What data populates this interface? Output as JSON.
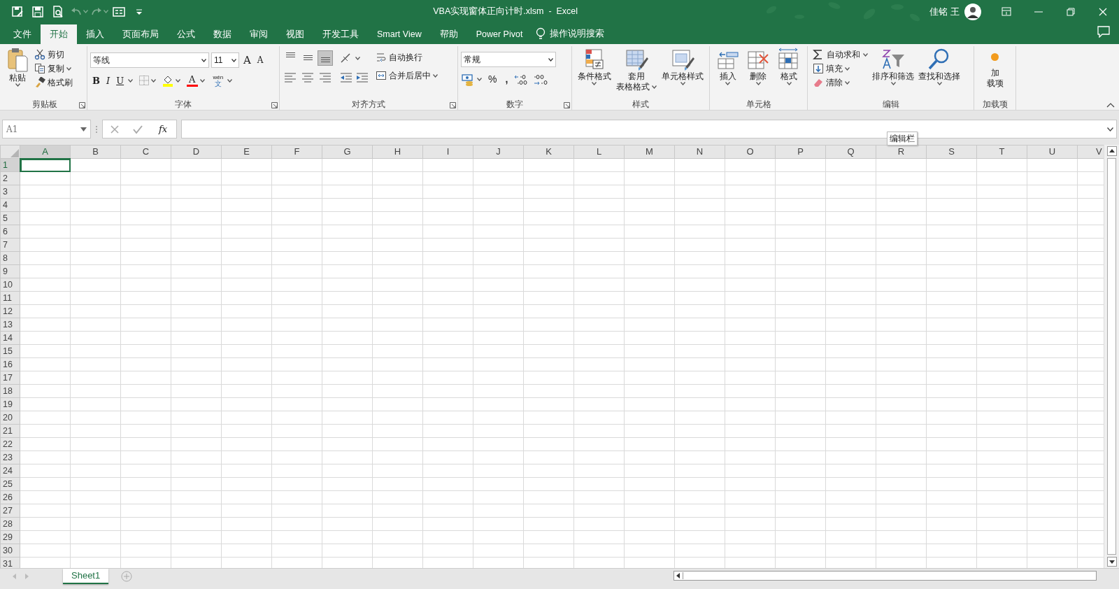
{
  "quick_access": [
    {
      "kind": "edit-save",
      "disabled": false
    },
    {
      "kind": "save",
      "disabled": false
    },
    {
      "kind": "preview",
      "disabled": false
    },
    {
      "kind": "undo",
      "disabled": true
    },
    {
      "kind": "redo",
      "disabled": true
    },
    {
      "kind": "form",
      "disabled": false
    },
    {
      "kind": "customize",
      "disabled": false
    }
  ],
  "window": {
    "title": "VBA实现窗体正向计时.xlsm  -  Excel",
    "user": "佳铭 王"
  },
  "tabs": [
    {
      "label": "文件",
      "selected": false
    },
    {
      "label": "开始",
      "selected": true
    },
    {
      "label": "插入",
      "selected": false
    },
    {
      "label": "页面布局",
      "selected": false
    },
    {
      "label": "公式",
      "selected": false
    },
    {
      "label": "数据",
      "selected": false
    },
    {
      "label": "审阅",
      "selected": false
    },
    {
      "label": "视图",
      "selected": false
    },
    {
      "label": "开发工具",
      "selected": false
    },
    {
      "label": "Smart View",
      "selected": false
    },
    {
      "label": "帮助",
      "selected": false
    },
    {
      "label": "Power Pivot",
      "selected": false
    }
  ],
  "tell_me": "操作说明搜索",
  "ribbon": {
    "clipboard": {
      "title": "剪贴板",
      "paste": "粘贴",
      "items": [
        {
          "kind": "cut",
          "label": "剪切",
          "dropdown": false
        },
        {
          "kind": "copy",
          "label": "复制",
          "dropdown": true
        },
        {
          "kind": "painter",
          "label": "格式刷",
          "dropdown": false
        }
      ]
    },
    "font": {
      "title": "字体",
      "font_name": "等线",
      "font_size": "11",
      "size_buttons": [
        {
          "kind": "grow",
          "glyph": "A"
        },
        {
          "kind": "shrink",
          "glyph": "A"
        }
      ],
      "style_buttons": [
        {
          "kind": "bold",
          "glyph": "B"
        },
        {
          "kind": "italic",
          "glyph": "I"
        },
        {
          "kind": "underline",
          "glyph": "U"
        }
      ],
      "font_color_glyph": "A",
      "phonetic": {
        "top": "wén",
        "bottom": "文"
      }
    },
    "alignment": {
      "title": "对齐方式",
      "vertical": [
        {
          "kind": "top",
          "selected": false
        },
        {
          "kind": "middle",
          "selected": false
        },
        {
          "kind": "bottom",
          "selected": true
        }
      ],
      "horizontal": [
        {
          "kind": "left",
          "selected": false
        },
        {
          "kind": "center",
          "selected": false
        },
        {
          "kind": "right",
          "selected": false
        }
      ],
      "wrap": "自动换行",
      "merge": "合并后居中"
    },
    "number": {
      "title": "数字",
      "format": "常规",
      "percent": "%",
      "comma": ","
    },
    "styles": {
      "title": "样式",
      "buttons": [
        {
          "kind": "conditional",
          "lines": [
            "条件格式"
          ]
        },
        {
          "kind": "table",
          "lines": [
            "套用",
            "表格格式"
          ]
        },
        {
          "kind": "cell-style",
          "lines": [
            "单元格样式"
          ]
        }
      ]
    },
    "cells": {
      "title": "单元格",
      "buttons": [
        {
          "kind": "insert",
          "label": "插入"
        },
        {
          "kind": "delete",
          "label": "删除"
        },
        {
          "kind": "format",
          "label": "格式"
        }
      ]
    },
    "editing": {
      "title": "编辑",
      "small": [
        {
          "kind": "sum",
          "label": "自动求和"
        },
        {
          "kind": "fill",
          "label": "填充"
        },
        {
          "kind": "clear",
          "label": "清除"
        }
      ],
      "large": [
        {
          "kind": "sort",
          "label": "排序和筛选"
        },
        {
          "kind": "find",
          "label": "查找和选择"
        }
      ]
    },
    "addins": {
      "title": "加载项",
      "lines": [
        "加",
        "载项"
      ]
    }
  },
  "formula_bar": {
    "name_box": "A1",
    "fx": "fx",
    "tooltip": "编辑栏"
  },
  "sheet": {
    "columns": [
      {
        "label": "A",
        "selected": true
      },
      {
        "label": "B",
        "selected": false
      },
      {
        "label": "C",
        "selected": false
      },
      {
        "label": "D",
        "selected": false
      },
      {
        "label": "E",
        "selected": false
      },
      {
        "label": "F",
        "selected": false
      },
      {
        "label": "G",
        "selected": false
      },
      {
        "label": "H",
        "selected": false
      },
      {
        "label": "I",
        "selected": false
      },
      {
        "label": "J",
        "selected": false
      },
      {
        "label": "K",
        "selected": false
      },
      {
        "label": "L",
        "selected": false
      },
      {
        "label": "M",
        "selected": false
      },
      {
        "label": "N",
        "selected": false
      },
      {
        "label": "O",
        "selected": false
      },
      {
        "label": "P",
        "selected": false
      },
      {
        "label": "Q",
        "selected": false
      },
      {
        "label": "R",
        "selected": false
      },
      {
        "label": "S",
        "selected": false
      },
      {
        "label": "T",
        "selected": false
      },
      {
        "label": "U",
        "selected": false
      },
      {
        "label": "V",
        "selected": false
      }
    ],
    "rows": [
      {
        "label": "1",
        "selected": true
      },
      {
        "label": "2",
        "selected": false
      },
      {
        "label": "3",
        "selected": false
      },
      {
        "label": "4",
        "selected": false
      },
      {
        "label": "5",
        "selected": false
      },
      {
        "label": "6",
        "selected": false
      },
      {
        "label": "7",
        "selected": false
      },
      {
        "label": "8",
        "selected": false
      },
      {
        "label": "9",
        "selected": false
      },
      {
        "label": "10",
        "selected": false
      },
      {
        "label": "11",
        "selected": false
      },
      {
        "label": "12",
        "selected": false
      },
      {
        "label": "13",
        "selected": false
      },
      {
        "label": "14",
        "selected": false
      },
      {
        "label": "15",
        "selected": false
      },
      {
        "label": "16",
        "selected": false
      },
      {
        "label": "17",
        "selected": false
      },
      {
        "label": "18",
        "selected": false
      },
      {
        "label": "19",
        "selected": false
      },
      {
        "label": "20",
        "selected": false
      },
      {
        "label": "21",
        "selected": false
      },
      {
        "label": "22",
        "selected": false
      },
      {
        "label": "23",
        "selected": false
      },
      {
        "label": "24",
        "selected": false
      },
      {
        "label": "25",
        "selected": false
      },
      {
        "label": "26",
        "selected": false
      },
      {
        "label": "27",
        "selected": false
      },
      {
        "label": "28",
        "selected": false
      },
      {
        "label": "29",
        "selected": false
      },
      {
        "label": "30",
        "selected": false
      },
      {
        "label": "31",
        "selected": false
      }
    ]
  },
  "sheet_tabs": [
    {
      "label": "Sheet1",
      "selected": true
    }
  ]
}
